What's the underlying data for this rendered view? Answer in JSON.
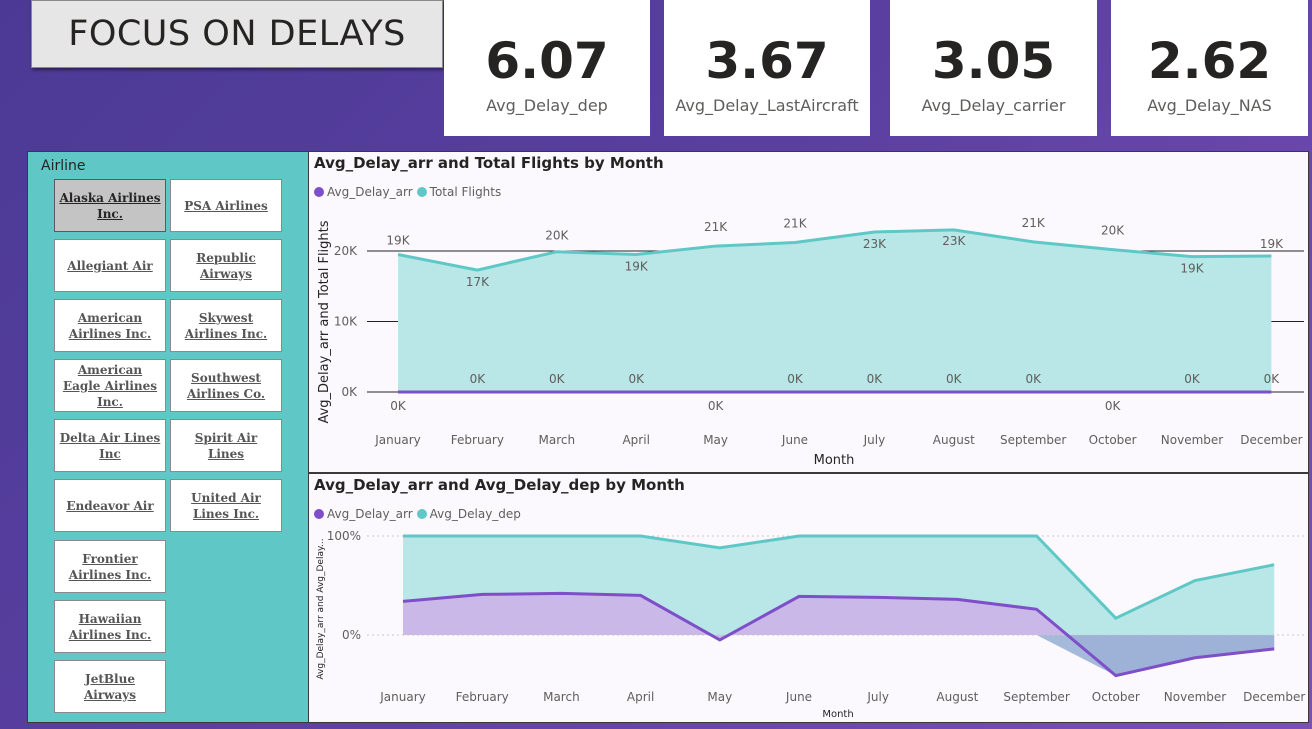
{
  "header": {
    "title": "FOCUS ON DELAYS"
  },
  "kpis": [
    {
      "value": "6.07",
      "label": "Avg_Delay_dep"
    },
    {
      "value": "3.67",
      "label": "Avg_Delay_LastAircraft"
    },
    {
      "value": "3.05",
      "label": "Avg_Delay_carrier"
    },
    {
      "value": "2.62",
      "label": "Avg_Delay_NAS"
    }
  ],
  "slicer": {
    "title": "Airline",
    "selected": "Alaska Airlines Inc.",
    "items": [
      "Alaska Airlines Inc.",
      "PSA Airlines",
      "Allegiant Air",
      "Republic Airways",
      "American Airlines Inc.",
      "Skywest Airlines Inc.",
      "American Eagle Airlines Inc.",
      "Southwest Airlines Co.",
      "Delta Air Lines Inc",
      "Spirit Air Lines",
      "Endeavor Air",
      "United Air Lines Inc.",
      "Frontier Airlines Inc.",
      "Hawaiian Airlines Inc.",
      "JetBlue Airways"
    ]
  },
  "colors": {
    "purple": "#7e4fc8",
    "teal": "#5fc8c6",
    "teal_fill": "#b9e6e6",
    "purple_fill": "#cbb3e8",
    "neg_fill": "#95afd3"
  },
  "chart_data": [
    {
      "type": "area",
      "title": "Avg_Delay_arr and Total Flights by Month",
      "xlabel": "Month",
      "ylabel": "Avg_Delay_arr and Total Flights",
      "legend_position": "top-left",
      "categories": [
        "January",
        "February",
        "March",
        "April",
        "May",
        "June",
        "July",
        "August",
        "September",
        "October",
        "November",
        "December"
      ],
      "series": [
        {
          "name": "Avg_Delay_arr",
          "values": [
            0,
            0,
            0,
            0,
            0,
            0,
            0,
            0,
            0,
            0,
            0,
            0
          ],
          "labels": [
            "0K",
            "0K",
            "0K",
            "0K",
            "0K",
            "0K",
            "0K",
            "0K",
            "0K",
            "0K",
            "0K",
            "0K"
          ]
        },
        {
          "name": "Total Flights",
          "values": [
            19500,
            17300,
            19900,
            19500,
            20700,
            21200,
            22700,
            23000,
            21300,
            20200,
            19200,
            19300
          ],
          "labels": [
            "19K",
            "17K",
            "20K",
            "19K",
            "21K",
            "21K",
            "23K",
            "23K",
            "21K",
            "20K",
            "19K",
            "19K"
          ]
        }
      ],
      "yticks": [
        "0K",
        "10K",
        "20K"
      ],
      "ylim": [
        0,
        24000
      ],
      "grid": true
    },
    {
      "type": "area",
      "title": "Avg_Delay_arr and Avg_Delay_dep by Month",
      "xlabel": "Month",
      "ylabel": "Avg_Delay_arr and Avg_Delay...",
      "legend_position": "top-left",
      "categories": [
        "January",
        "February",
        "March",
        "April",
        "May",
        "June",
        "July",
        "August",
        "September",
        "October",
        "November",
        "December"
      ],
      "series": [
        {
          "name": "Avg_Delay_arr",
          "values": [
            0.34,
            0.41,
            0.42,
            0.4,
            -0.05,
            0.39,
            0.38,
            0.36,
            0.26,
            -0.41,
            -0.23,
            -0.14
          ]
        },
        {
          "name": "Avg_Delay_dep",
          "values": [
            1.0,
            1.0,
            1.0,
            1.0,
            0.88,
            1.0,
            1.0,
            1.0,
            1.0,
            0.17,
            0.55,
            0.71
          ]
        }
      ],
      "yticks": [
        "0%",
        "100%"
      ],
      "ylim": [
        -0.5,
        1.1
      ],
      "grid": false
    }
  ]
}
